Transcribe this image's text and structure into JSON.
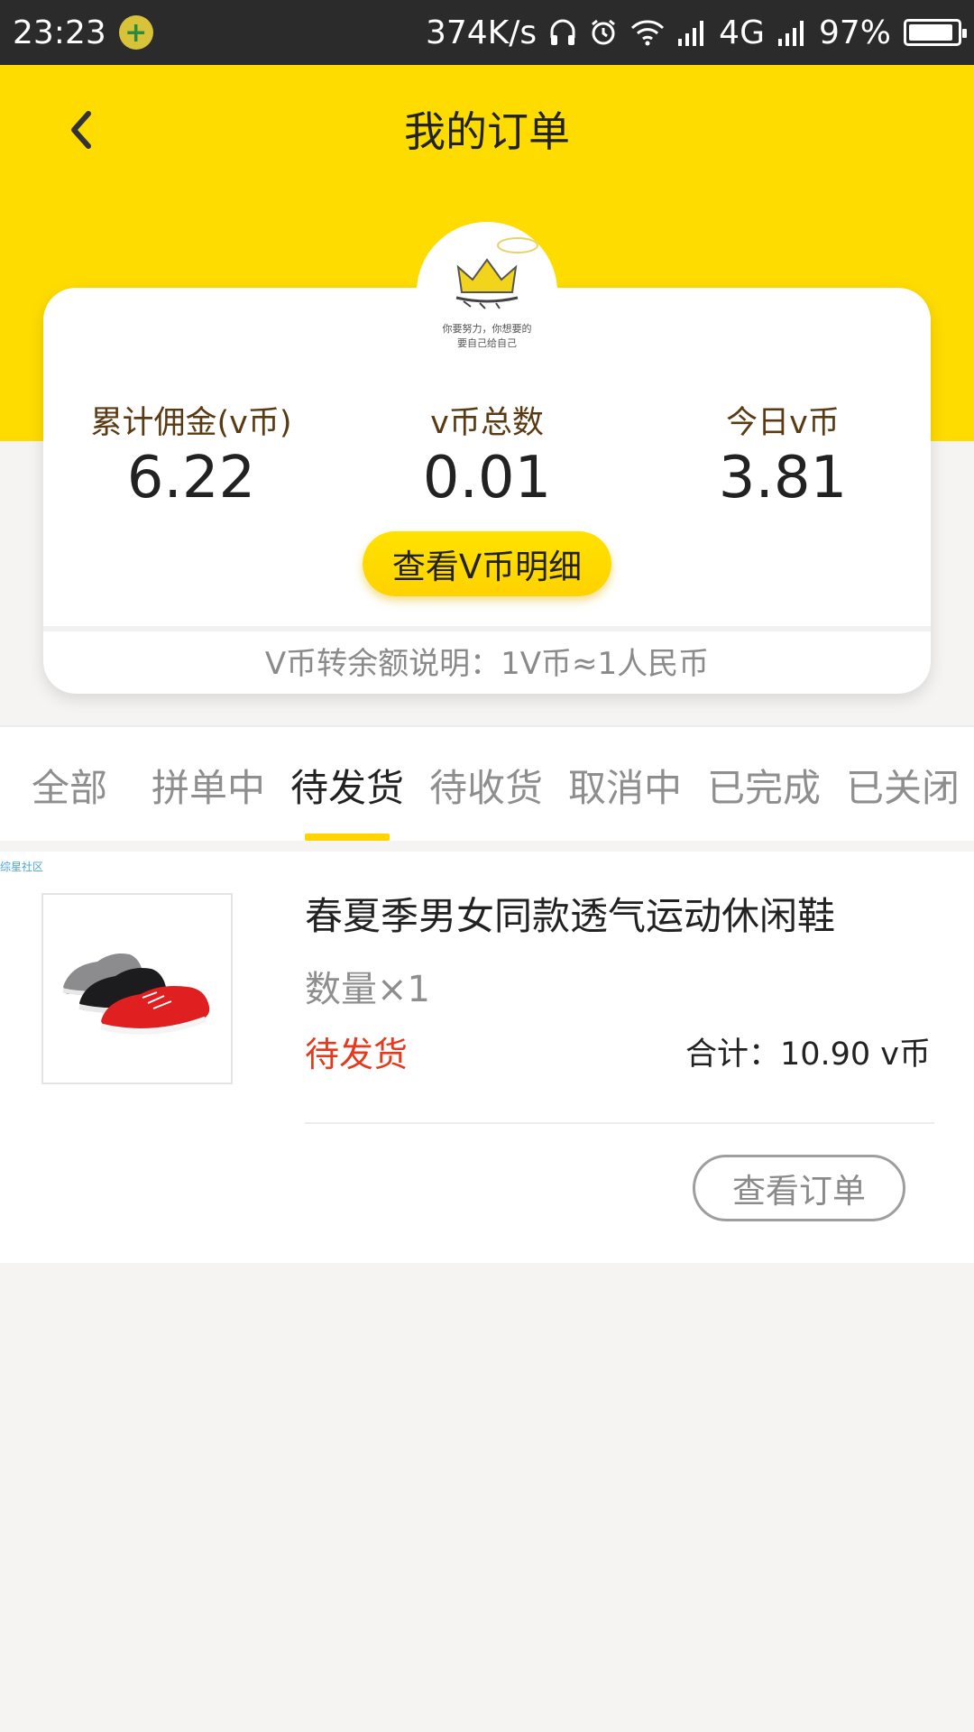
{
  "status_bar": {
    "time": "23:23",
    "net_speed": "374K/s",
    "network": "4G",
    "battery": "97%"
  },
  "header": {
    "title": "我的订单",
    "avatar_caption_1": "你要努力，你想要的",
    "avatar_caption_2": "要自己给自己"
  },
  "stats": [
    {
      "label": "累计佣金(v币)",
      "value": "6.22"
    },
    {
      "label": "v币总数",
      "value": "0.01"
    },
    {
      "label": "今日v币",
      "value": "3.81"
    }
  ],
  "detail_button": "查看V币明细",
  "rate_note": "V币转余额说明：1V币≈1人民币",
  "tabs": [
    {
      "label": "全部"
    },
    {
      "label": "拼单中"
    },
    {
      "label": "待发货"
    },
    {
      "label": "待收货"
    },
    {
      "label": "取消中"
    },
    {
      "label": "已完成"
    },
    {
      "label": "已关闭"
    }
  ],
  "order": {
    "watermark": "综星社区",
    "product_name": "春夏季男女同款透气运动休闲鞋",
    "quantity": "数量×1",
    "status": "待发货",
    "total": "合计：10.90 v币",
    "view_button": "查看订单"
  },
  "colors": {
    "header_yellow": "#ffdc00",
    "status_red": "#e63a1e",
    "page_bg": "#f5f4f2"
  }
}
